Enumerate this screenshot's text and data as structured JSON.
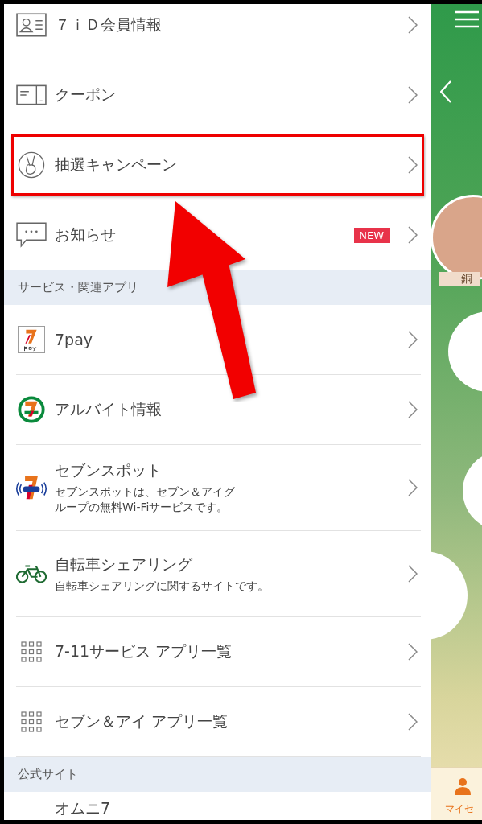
{
  "menu": {
    "sections": [
      {
        "items": [
          {
            "kind": "member",
            "label": "７ｉＤ会員情報",
            "highlighted": false
          },
          {
            "kind": "coupon",
            "label": "クーポン",
            "highlighted": false
          },
          {
            "kind": "peace",
            "label": "抽選キャンペーン",
            "highlighted": true
          },
          {
            "kind": "message",
            "label": "お知らせ",
            "badge": "NEW",
            "highlighted": false
          }
        ]
      },
      {
        "header": "サービス・関連アプリ",
        "items": [
          {
            "kind": "pay",
            "label": "7pay",
            "highlighted": false
          },
          {
            "kind": "seven",
            "label": "アルバイト情報",
            "highlighted": false
          },
          {
            "kind": "spot",
            "label": "セブンスポット",
            "subtitle": "セブンスポットは、セブン＆アイグループの無料Wi-Fiサービスです。",
            "highlighted": false
          },
          {
            "kind": "bike",
            "label": "自転車シェアリング",
            "subtitle": "自転車シェアリングに関するサイトです。",
            "highlighted": false
          },
          {
            "kind": "grid",
            "label": "7-11サービス アプリ一覧",
            "highlighted": false
          },
          {
            "kind": "grid",
            "label": "セブン＆アイ アプリ一覧",
            "highlighted": false
          }
        ]
      },
      {
        "header": "公式サイト",
        "items": [
          {
            "kind": "site",
            "label": "オムニ7",
            "highlighted": false
          }
        ]
      }
    ]
  },
  "side_panel": {
    "ribbon": "銅",
    "tab_label": "マイセ"
  }
}
